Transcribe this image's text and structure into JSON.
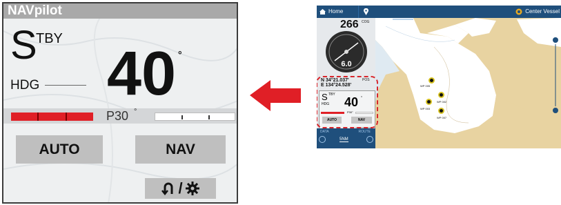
{
  "zoom_panel": {
    "title": "NAVpilot",
    "mode_letter": "S",
    "mode_sub": "TBY",
    "heading_label": "HDG",
    "heading_value": "40",
    "heading_unit": "°",
    "rudder_text": "P30",
    "rudder_unit": "°",
    "rudder_port_fraction": 1.0,
    "auto_label": "AUTO",
    "nav_label": "NAV",
    "util_separator": "/",
    "util_icons": [
      "u-turn-icon",
      "gear-icon"
    ]
  },
  "arrow": {
    "color": "#e01f26",
    "direction": "left"
  },
  "tablet": {
    "home_label": "Home",
    "center_label": "Center Vessel",
    "cog_value": "266",
    "cog_label": "COG",
    "speed_value": "6.0",
    "pos_lat": "N 34°21.037'",
    "pos_lon": "E 134°24.528'",
    "pos_label": "POS",
    "ap_mode": "S",
    "ap_sub": "TBY",
    "ap_hdg_label": "HDG",
    "ap_hdg_value": "40",
    "ap_rudder": "P30°",
    "ap_auto": "AUTO",
    "ap_nav": "NAV",
    "ap_util": "∩ / ⚙",
    "bottom_left": "DATA",
    "bottom_right": "ROUTE",
    "scale": "5NM",
    "waypoints": [
      "WP 005",
      "WP 002",
      "WP 003",
      "WP 007"
    ]
  },
  "colors": {
    "title_bar": "#a9a9a9",
    "rudder_red": "#e01f26",
    "tablet_bar": "#1f4f7c",
    "land": "#e8d3a1",
    "water": "#ffffff",
    "highlight": "#d8262c"
  }
}
